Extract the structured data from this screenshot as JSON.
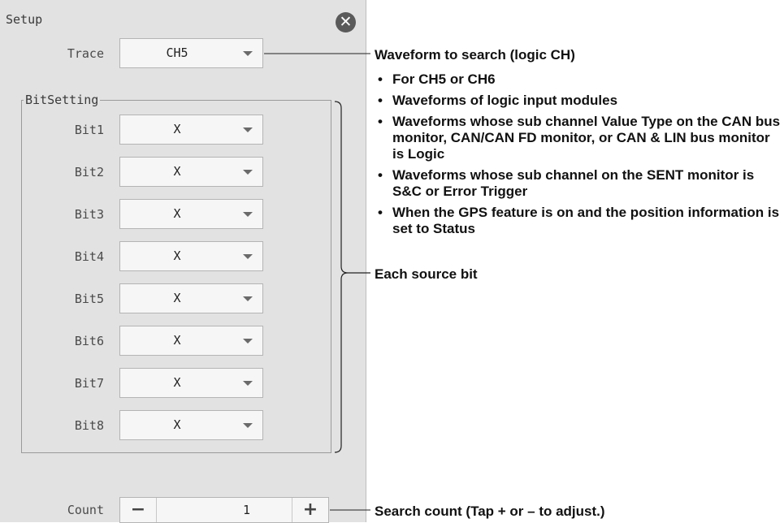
{
  "panel": {
    "title": "Setup",
    "close_icon": "close-icon"
  },
  "trace": {
    "label": "Trace",
    "value": "CH5"
  },
  "bit_setting": {
    "title": "BitSetting",
    "bits": [
      {
        "label": "Bit1",
        "value": "X"
      },
      {
        "label": "Bit2",
        "value": "X"
      },
      {
        "label": "Bit3",
        "value": "X"
      },
      {
        "label": "Bit4",
        "value": "X"
      },
      {
        "label": "Bit5",
        "value": "X"
      },
      {
        "label": "Bit6",
        "value": "X"
      },
      {
        "label": "Bit7",
        "value": "X"
      },
      {
        "label": "Bit8",
        "value": "X"
      }
    ]
  },
  "count": {
    "label": "Count",
    "value": "1",
    "minus": "−",
    "plus": "+"
  },
  "annotations": {
    "waveform_heading": "Waveform to search (logic CH)",
    "waveform_items": [
      "For CH5 or CH6",
      "Waveforms of logic input modules",
      "Waveforms whose sub channel Value Type on the CAN bus monitor, CAN/CAN FD monitor, or CAN & LIN bus monitor is Logic",
      "Waveforms whose sub channel on the SENT monitor is S&C or Error Trigger",
      "When the GPS feature is on and the position information is set to Status"
    ],
    "bullet": "•",
    "each_source_bit": "Each source bit",
    "search_count": "Search count (Tap + or – to adjust.)"
  }
}
